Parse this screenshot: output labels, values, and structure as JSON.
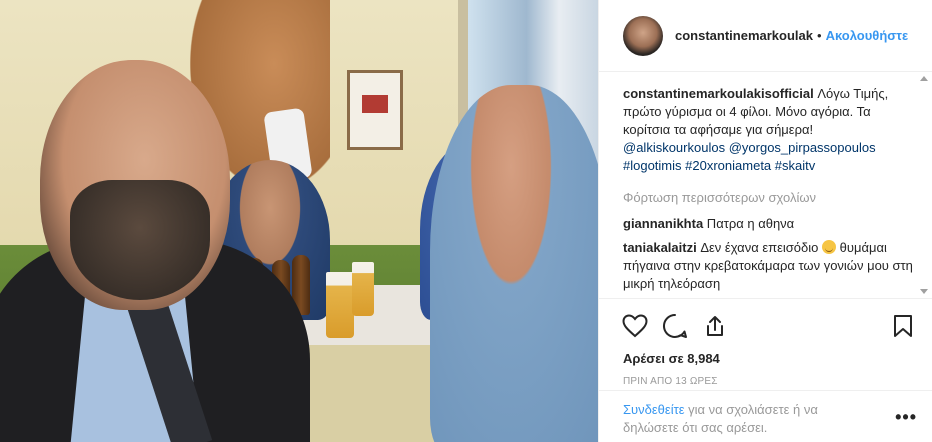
{
  "photo": {
    "alt_icon": "post-photo"
  },
  "header": {
    "username": "constantinemarkoulak",
    "separator": "•",
    "follow_label": "Ακολουθήστε"
  },
  "caption": {
    "author": "constantinemarkoulakisofficial",
    "text": " Λόγω Τιμής, πρώτο γύρισμα οι 4 φίλοι. Μόνο αγόρια. Τα κορίτσια τα αφήσαμε για σήμερα! ",
    "mention_1": "@alkiskourkoulos",
    "mention_2": "@yorgos_pirpassopoulos",
    "hashtag_1": "#logotimis",
    "hashtag_2": "#20xroniameta",
    "hashtag_3": "#skaitv"
  },
  "load_more": "Φόρτωση περισσότερων σχολίων",
  "comments": [
    {
      "author": "giannanikhta",
      "text": " Πατρα η αθηνα"
    },
    {
      "author": "taniakalaitzi",
      "text": " Δεν έχανα επεισόδιο",
      "text_2": "θυμάμαι πήγαινα στην κρεβατοκάμαρα των γονιών μου στη μικρή τηλεόραση"
    }
  ],
  "actions": {
    "likes": "Αρέσει σε 8,984",
    "time": "ΠΡΙΝ ΑΠΟ 13 ΩΡΕΣ"
  },
  "footer": {
    "login_link": "Συνδεθείτε",
    "text": " για να σχολιάσετε ή να δηλώσετε ότι σας αρέσει.",
    "more": "•••"
  },
  "colors": {
    "link_blue": "#3897f0",
    "mention_blue": "#003569",
    "muted": "#999999"
  }
}
